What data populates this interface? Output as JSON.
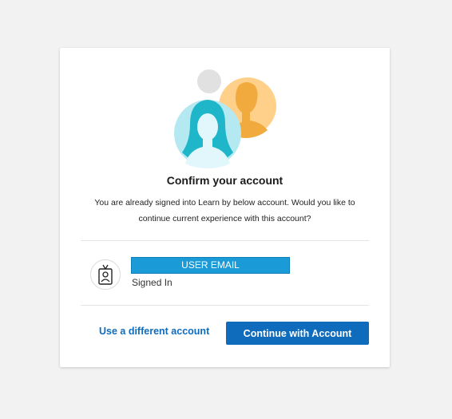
{
  "dialog": {
    "title": "Confirm your account",
    "description": "You are already signed into Learn by below account. Would you like to continue current experience with this account?"
  },
  "account": {
    "email": "USER EMAIL",
    "status": "Signed In",
    "icon": "id-badge-icon"
  },
  "actions": {
    "different_account_label": "Use a different account",
    "continue_label": "Continue with Account"
  },
  "colors": {
    "primary": "#0f6cbd",
    "email_highlight": "#1a9ad6",
    "background": "#f2f2f2"
  }
}
